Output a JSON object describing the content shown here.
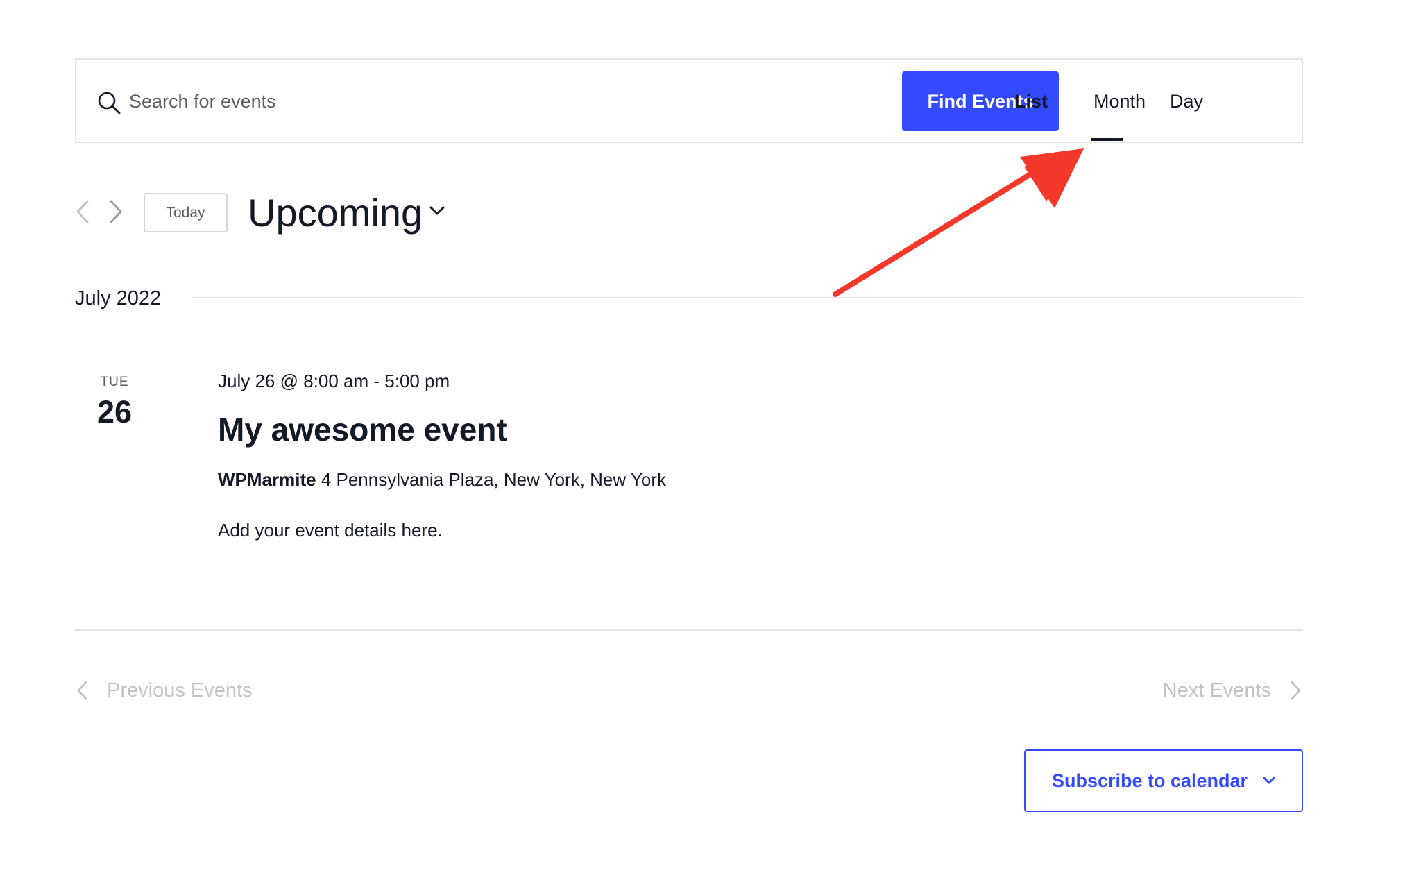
{
  "search": {
    "placeholder": "Search for events",
    "find_label": "Find Events"
  },
  "views": {
    "list": "List",
    "month": "Month",
    "day": "Day",
    "active": "List"
  },
  "nav": {
    "today_label": "Today",
    "range_label": "Upcoming"
  },
  "month_separator": "July 2022",
  "event": {
    "day_of_week": "TUE",
    "day_number": "26",
    "datetime": "July 26 @ 8:00 am - 5:00 pm",
    "title": "My awesome event",
    "venue_name": "WPMarmite",
    "venue_address": "4 Pennsylvania Plaza, New York, New York",
    "description": "Add your event details here."
  },
  "pagination": {
    "previous_label": "Previous Events",
    "next_label": "Next Events"
  },
  "subscribe_label": "Subscribe to calendar",
  "colors": {
    "accent": "#334aff",
    "annotation": "#f4392a",
    "text": "#141827",
    "muted": "#c3c3c3"
  },
  "icons": [
    "search-icon",
    "chevron-left-icon",
    "chevron-right-icon",
    "chevron-down-icon",
    "annotation-arrow"
  ]
}
